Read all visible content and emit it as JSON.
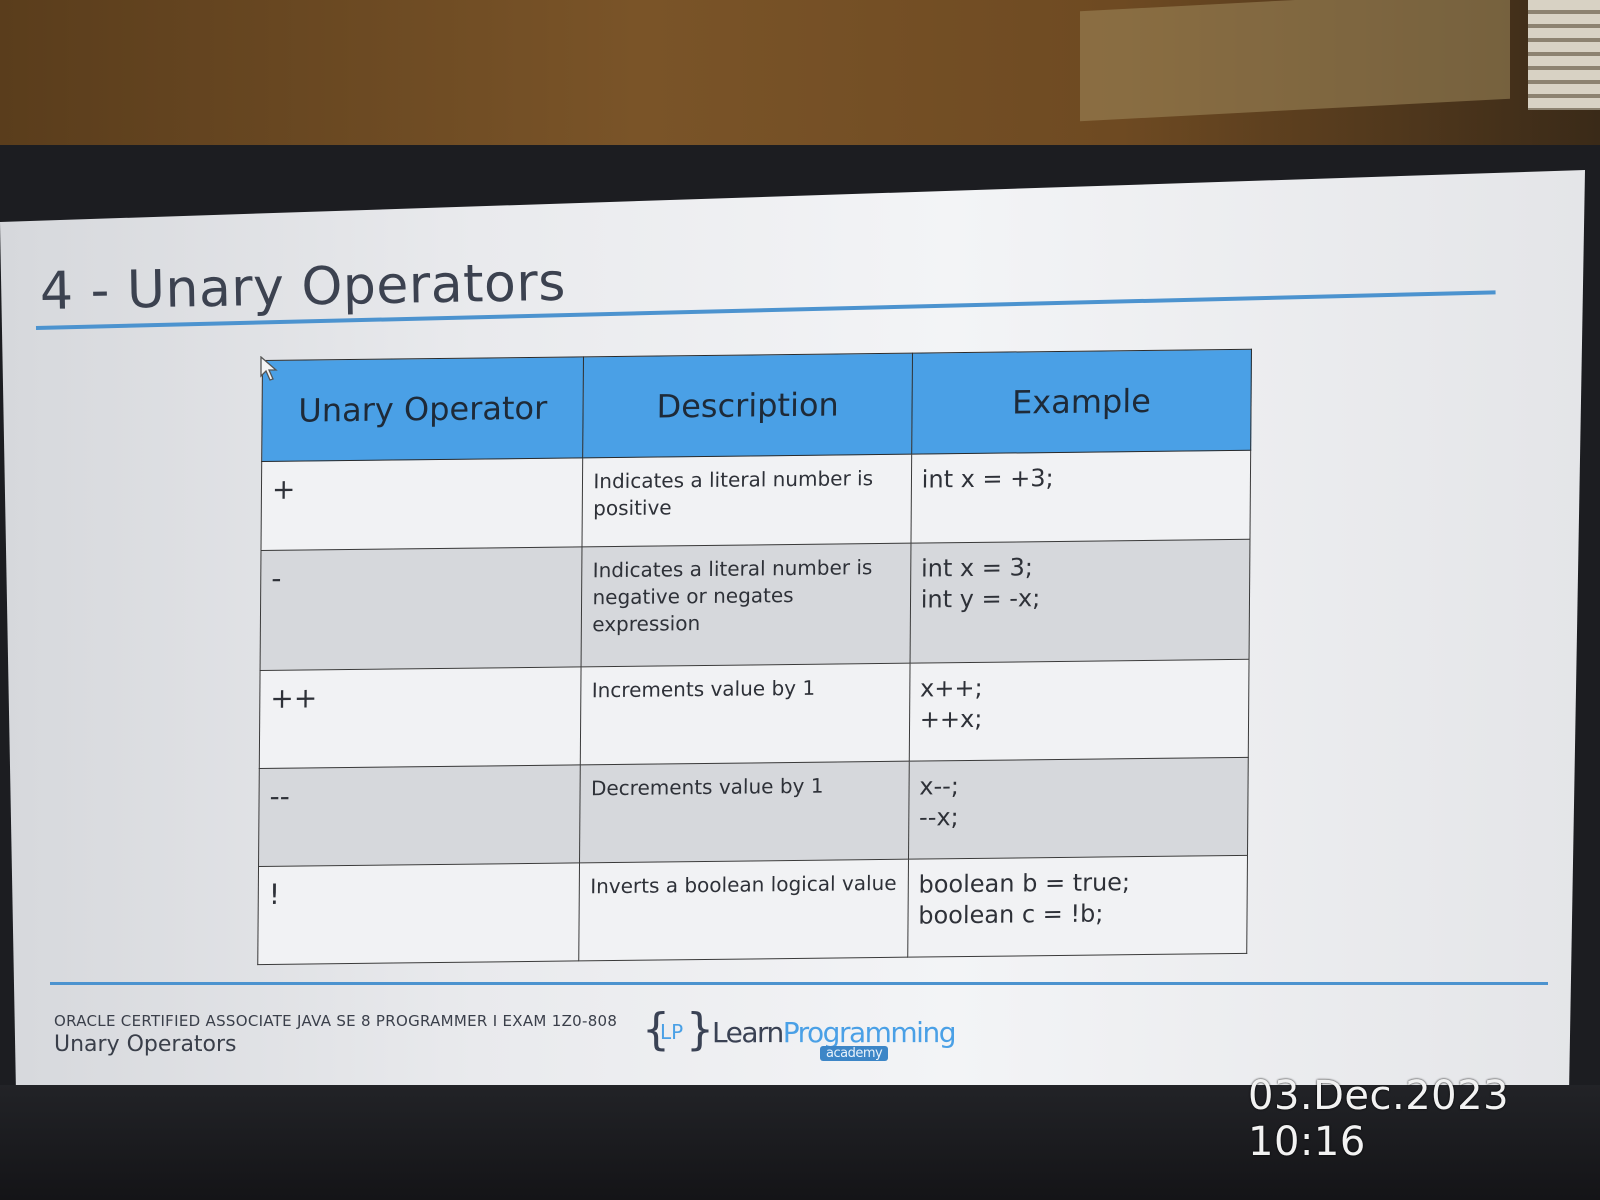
{
  "slide": {
    "title": "4 - Unary Operators",
    "headers": [
      "Unary Operator",
      "Description",
      "Example"
    ],
    "rows": [
      {
        "operator": "+",
        "description": "Indicates a literal number is positive",
        "example": "int x = +3;"
      },
      {
        "operator": "-",
        "description": "Indicates a literal number is negative or negates expression",
        "example": "int x = 3;\nint y = -x;"
      },
      {
        "operator": "++",
        "description": "Increments value by 1",
        "example": "x++;\n++x;"
      },
      {
        "operator": "--",
        "description": "Decrements value by 1",
        "example": "x--;\n--x;"
      },
      {
        "operator": "!",
        "description": "Inverts a boolean logical value",
        "example": "boolean b = true;\nboolean c = !b;"
      }
    ],
    "footer": {
      "course": "ORACLE CERTIFIED ASSOCIATE JAVA SE 8 PROGRAMMER I EXAM 1Z0-808",
      "subtitle": "Unary Operators"
    },
    "logo": {
      "initials": "LP",
      "word_part1": "Learn",
      "word_part2": "Programming",
      "tag": "academy"
    },
    "accent_color": "#4aa0e6",
    "rule_color": "#4c93cf"
  },
  "photo": {
    "timestamp": "03.Dec.2023 10:16"
  }
}
